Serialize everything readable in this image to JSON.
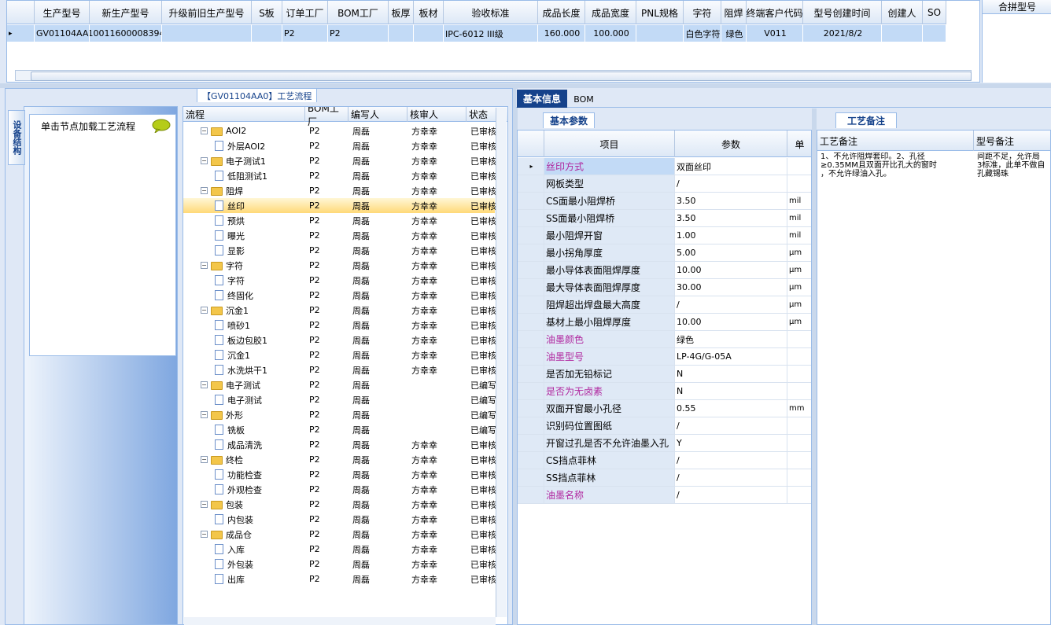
{
  "top_grid": {
    "headers": [
      "生产型号",
      "新生产型号",
      "升级前旧生产型号",
      "S板",
      "订单工厂",
      "BOM工厂",
      "板厚",
      "板材",
      "验收标准",
      "成品长度",
      "成品宽度",
      "PNL规格",
      "字符",
      "阻焊",
      "终端客户代码",
      "型号创建时间",
      "创建人",
      "SO"
    ],
    "row": [
      "GV01104AA0",
      "10011600008394",
      "",
      "",
      "P2",
      "P2",
      "",
      "",
      "IPC-6012 III级",
      "160.000",
      "100.000",
      "",
      "白色字符",
      "绿色",
      "V011",
      "2021/8/2",
      "",
      ""
    ]
  },
  "merge_panel": {
    "header": "合拼型号"
  },
  "process_tab_label": "【GV01104AA0】工艺流程",
  "vertical_tab_label": "设备结构",
  "load_button_label": "单击节点加载工艺流程",
  "tree": {
    "headers": [
      "流程",
      "BOM工厂",
      "编写人",
      "核审人",
      "状态"
    ],
    "rows": [
      {
        "level": 1,
        "type": "folder",
        "name": "AOI2",
        "bom": "P2",
        "writer": "周磊",
        "reviewer": "方幸幸",
        "status": "已审核"
      },
      {
        "level": 2,
        "type": "file",
        "name": "外层AOI2",
        "bom": "P2",
        "writer": "周磊",
        "reviewer": "方幸幸",
        "status": "已审核"
      },
      {
        "level": 1,
        "type": "folder",
        "name": "电子测试1",
        "bom": "P2",
        "writer": "周磊",
        "reviewer": "方幸幸",
        "status": "已审核"
      },
      {
        "level": 2,
        "type": "file",
        "name": "低阻测试1",
        "bom": "P2",
        "writer": "周磊",
        "reviewer": "方幸幸",
        "status": "已审核"
      },
      {
        "level": 1,
        "type": "folder",
        "name": "阻焊",
        "bom": "P2",
        "writer": "周磊",
        "reviewer": "方幸幸",
        "status": "已审核"
      },
      {
        "level": 2,
        "type": "file",
        "name": "丝印",
        "bom": "P2",
        "writer": "周磊",
        "reviewer": "方幸幸",
        "status": "已审核",
        "selected": true
      },
      {
        "level": 2,
        "type": "file",
        "name": "预烘",
        "bom": "P2",
        "writer": "周磊",
        "reviewer": "方幸幸",
        "status": "已审核"
      },
      {
        "level": 2,
        "type": "file",
        "name": "曝光",
        "bom": "P2",
        "writer": "周磊",
        "reviewer": "方幸幸",
        "status": "已审核"
      },
      {
        "level": 2,
        "type": "file",
        "name": "显影",
        "bom": "P2",
        "writer": "周磊",
        "reviewer": "方幸幸",
        "status": "已审核"
      },
      {
        "level": 1,
        "type": "folder",
        "name": "字符",
        "bom": "P2",
        "writer": "周磊",
        "reviewer": "方幸幸",
        "status": "已审核"
      },
      {
        "level": 2,
        "type": "file",
        "name": "字符",
        "bom": "P2",
        "writer": "周磊",
        "reviewer": "方幸幸",
        "status": "已审核"
      },
      {
        "level": 2,
        "type": "file",
        "name": "终固化",
        "bom": "P2",
        "writer": "周磊",
        "reviewer": "方幸幸",
        "status": "已审核"
      },
      {
        "level": 1,
        "type": "folder",
        "name": "沉金1",
        "bom": "P2",
        "writer": "周磊",
        "reviewer": "方幸幸",
        "status": "已审核"
      },
      {
        "level": 2,
        "type": "file",
        "name": "喷砂1",
        "bom": "P2",
        "writer": "周磊",
        "reviewer": "方幸幸",
        "status": "已审核"
      },
      {
        "level": 2,
        "type": "file",
        "name": "板边包胶1",
        "bom": "P2",
        "writer": "周磊",
        "reviewer": "方幸幸",
        "status": "已审核"
      },
      {
        "level": 2,
        "type": "file",
        "name": "沉金1",
        "bom": "P2",
        "writer": "周磊",
        "reviewer": "方幸幸",
        "status": "已审核"
      },
      {
        "level": 2,
        "type": "file",
        "name": "水洗烘干1",
        "bom": "P2",
        "writer": "周磊",
        "reviewer": "方幸幸",
        "status": "已审核"
      },
      {
        "level": 1,
        "type": "folder",
        "name": "电子测试",
        "bom": "P2",
        "writer": "周磊",
        "reviewer": "",
        "status": "已编写"
      },
      {
        "level": 2,
        "type": "file",
        "name": "电子测试",
        "bom": "P2",
        "writer": "周磊",
        "reviewer": "",
        "status": "已编写"
      },
      {
        "level": 1,
        "type": "folder",
        "name": "外形",
        "bom": "P2",
        "writer": "周磊",
        "reviewer": "",
        "status": "已编写"
      },
      {
        "level": 2,
        "type": "file",
        "name": "铣板",
        "bom": "P2",
        "writer": "周磊",
        "reviewer": "",
        "status": "已编写"
      },
      {
        "level": 2,
        "type": "file",
        "name": "成品清洗",
        "bom": "P2",
        "writer": "周磊",
        "reviewer": "方幸幸",
        "status": "已审核"
      },
      {
        "level": 1,
        "type": "folder",
        "name": "终检",
        "bom": "P2",
        "writer": "周磊",
        "reviewer": "方幸幸",
        "status": "已审核"
      },
      {
        "level": 2,
        "type": "file",
        "name": "功能检查",
        "bom": "P2",
        "writer": "周磊",
        "reviewer": "方幸幸",
        "status": "已审核"
      },
      {
        "level": 2,
        "type": "file",
        "name": "外观检查",
        "bom": "P2",
        "writer": "周磊",
        "reviewer": "方幸幸",
        "status": "已审核"
      },
      {
        "level": 1,
        "type": "folder",
        "name": "包装",
        "bom": "P2",
        "writer": "周磊",
        "reviewer": "方幸幸",
        "status": "已审核"
      },
      {
        "level": 2,
        "type": "file",
        "name": "内包装",
        "bom": "P2",
        "writer": "周磊",
        "reviewer": "方幸幸",
        "status": "已审核"
      },
      {
        "level": 1,
        "type": "folder",
        "name": "成品仓",
        "bom": "P2",
        "writer": "周磊",
        "reviewer": "方幸幸",
        "status": "已审核"
      },
      {
        "level": 2,
        "type": "file",
        "name": "入库",
        "bom": "P2",
        "writer": "周磊",
        "reviewer": "方幸幸",
        "status": "已审核"
      },
      {
        "level": 2,
        "type": "file",
        "name": "外包装",
        "bom": "P2",
        "writer": "周磊",
        "reviewer": "方幸幸",
        "status": "已审核"
      },
      {
        "level": 2,
        "type": "file",
        "name": "出库",
        "bom": "P2",
        "writer": "周磊",
        "reviewer": "方幸幸",
        "status": "已审核"
      }
    ]
  },
  "tabs": {
    "basic": "基本信息",
    "bom": "BOM"
  },
  "param_tab_label": "基本参数",
  "params": {
    "headers": [
      "项目",
      "参数",
      "单"
    ],
    "rows": [
      {
        "item": "丝印方式",
        "value": "双面丝印",
        "unit": "",
        "highlight": true,
        "current": true
      },
      {
        "item": "网板类型",
        "value": "/",
        "unit": ""
      },
      {
        "item": "CS面最小阻焊桥",
        "value": "3.50",
        "unit": "mil"
      },
      {
        "item": "SS面最小阻焊桥",
        "value": "3.50",
        "unit": "mil"
      },
      {
        "item": "最小阻焊开窗",
        "value": "1.00",
        "unit": "mil"
      },
      {
        "item": "最小拐角厚度",
        "value": "5.00",
        "unit": "μm"
      },
      {
        "item": "最小导体表面阻焊厚度",
        "value": "10.00",
        "unit": "μm"
      },
      {
        "item": "最大导体表面阻焊厚度",
        "value": "30.00",
        "unit": "μm"
      },
      {
        "item": "阻焊超出焊盘最大高度",
        "value": "/",
        "unit": "μm"
      },
      {
        "item": "基材上最小阻焊厚度",
        "value": "10.00",
        "unit": "μm"
      },
      {
        "item": "油墨颜色",
        "value": "绿色",
        "unit": "",
        "highlight": true
      },
      {
        "item": "油墨型号",
        "value": "LP-4G/G-05A",
        "unit": "",
        "highlight": true
      },
      {
        "item": "是否加无铅标记",
        "value": "N",
        "unit": ""
      },
      {
        "item": "是否为无卤素",
        "value": "N",
        "unit": "",
        "highlight": true
      },
      {
        "item": "双面开窗最小孔径",
        "value": "0.55",
        "unit": "mm"
      },
      {
        "item": "识别码位置图纸",
        "value": "/",
        "unit": ""
      },
      {
        "item": "开窗过孔是否不允许油墨入孔",
        "value": "Y",
        "unit": ""
      },
      {
        "item": "CS挡点菲林",
        "value": "/",
        "unit": ""
      },
      {
        "item": "SS挡点菲林",
        "value": "/",
        "unit": ""
      },
      {
        "item": "油墨名称",
        "value": "/",
        "unit": "",
        "highlight": true
      }
    ]
  },
  "notes": {
    "tab_label": "工艺备注",
    "headers": [
      "工艺备注",
      "型号备注"
    ],
    "process_note": "1、不允许阻焊套印。2、孔径\n≥0.35MM且双面开比孔大的窗时\n，不允许绿油入孔。",
    "model_note": "间距不足，允许局\n3标准，此单不做自\n孔藏锡珠"
  },
  "colors": {
    "accent": "#15428b",
    "highlight_text": "#b0279f",
    "selected_row": "#c2daf6",
    "border": "#99bbe8"
  }
}
